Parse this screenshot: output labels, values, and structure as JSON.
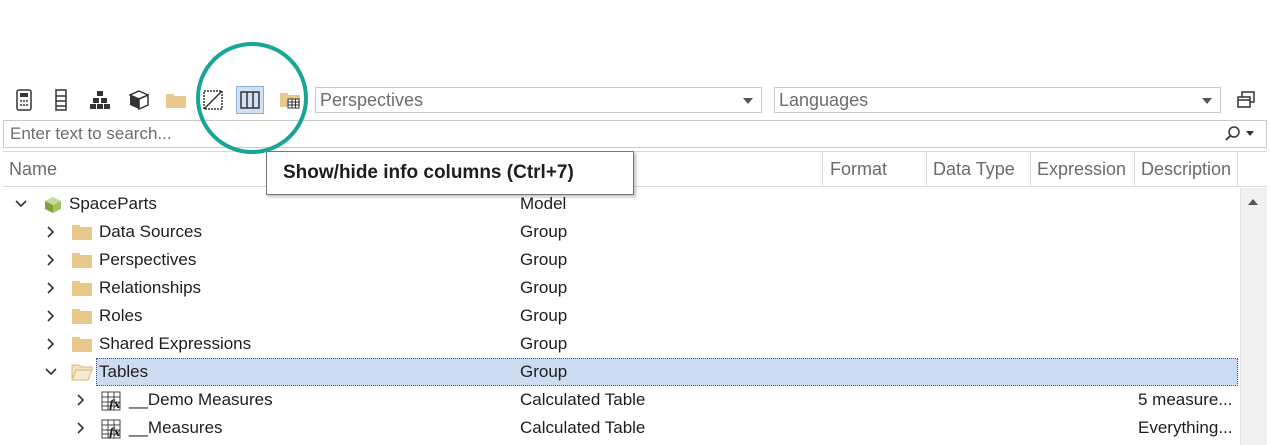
{
  "toolbar": {
    "buttons": [
      {
        "name": "calculator-icon"
      },
      {
        "name": "column-list-icon"
      },
      {
        "name": "hierarchy-icon"
      },
      {
        "name": "cube-icon"
      },
      {
        "name": "folder-icon"
      },
      {
        "name": "slash-box-icon"
      },
      {
        "name": "info-columns-icon",
        "active": true
      },
      {
        "name": "folder-table-icon"
      }
    ],
    "perspectives_placeholder": "Perspectives",
    "languages_placeholder": "Languages"
  },
  "search": {
    "placeholder": "Enter text to search..."
  },
  "columns": {
    "name": "Name",
    "format": "Format",
    "data_type": "Data Type",
    "expression": "Expression",
    "description": "Description"
  },
  "tooltip": {
    "text": "Show/hide info columns (Ctrl+7)"
  },
  "tree": [
    {
      "label": "SpaceParts",
      "type": "Model",
      "description": "",
      "icon": "model-cube-icon",
      "expanded": true
    },
    {
      "label": "Data Sources",
      "type": "Group",
      "description": "",
      "icon": "folder-icon",
      "expanded": false
    },
    {
      "label": "Perspectives",
      "type": "Group",
      "description": "",
      "icon": "folder-icon",
      "expanded": false
    },
    {
      "label": "Relationships",
      "type": "Group",
      "description": "",
      "icon": "folder-icon",
      "expanded": false
    },
    {
      "label": "Roles",
      "type": "Group",
      "description": "",
      "icon": "folder-icon",
      "expanded": false
    },
    {
      "label": "Shared Expressions",
      "type": "Group",
      "description": "",
      "icon": "folder-icon",
      "expanded": false
    },
    {
      "label": "Tables",
      "type": "Group",
      "description": "",
      "icon": "folder-open-icon",
      "expanded": true,
      "selected": true
    },
    {
      "label": "__Demo Measures",
      "type": "Calculated Table",
      "description": "5 measure...",
      "icon": "calculated-table-icon",
      "expanded": false
    },
    {
      "label": "__Measures",
      "type": "Calculated Table",
      "description": "Everything...",
      "icon": "calculated-table-icon",
      "expanded": false
    }
  ],
  "colors": {
    "accent_ring": "#17a596",
    "selection": "#cddcf3",
    "folder": "#e8c98c"
  }
}
